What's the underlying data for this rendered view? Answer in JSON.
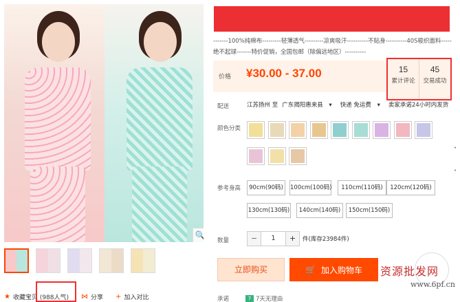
{
  "product": {
    "subtitle": "-------100%纯棉布---------轻薄透气---------凉爽吸汗----------不贴身----------40S梭织面料-----绝不起球-------特价促销，全国包邮（除偏远地区）----------"
  },
  "price": {
    "label": "价格",
    "value": "¥30.00 - 37.00"
  },
  "stats": {
    "reviews": {
      "count": "15",
      "label": "累计评论"
    },
    "sold": {
      "count": "45",
      "label": "交易成功"
    }
  },
  "shipping": {
    "label": "配送",
    "from": "江苏扬州 至",
    "to": "广东揭阳惠来县",
    "to_arrow": "▾",
    "method": "快递 免运费",
    "method_arrow": "▾",
    "promise": "卖家承诺24小时内发货"
  },
  "color": {
    "label": "颜色分类",
    "swatches": [
      {
        "color": "#f1df9a"
      },
      {
        "color": "#e8d9b8"
      },
      {
        "color": "#f3d2a8"
      },
      {
        "color": "#e8c68f"
      },
      {
        "color": "#8fcfcf"
      },
      {
        "color": "#a7ddd4"
      },
      {
        "color": "#d9b4e3"
      },
      {
        "color": "#f2b7c1"
      },
      {
        "color": "#c6c6e8"
      },
      {
        "color": "#e8c4d6"
      },
      {
        "color": "#f3e0a8"
      },
      {
        "color": "#e6c8a6"
      }
    ]
  },
  "size": {
    "label": "参考身高",
    "options": [
      "90cm(90码)",
      "100cm(100码)",
      "110cm(110码)",
      "120cm(120码)",
      "130cm(130码)",
      "140cm(140码)",
      "150cm(150码)"
    ]
  },
  "quantity": {
    "label": "数量",
    "minus": "−",
    "value": "1",
    "plus": "+",
    "stock": "件(库存23984件)"
  },
  "actions": {
    "buy_now": "立即购买",
    "add_cart": "加入购物车",
    "cart_icon": "🛒"
  },
  "promise_row": {
    "label": "承诺",
    "badge": "7",
    "text": "7天无理由"
  },
  "bottom": {
    "favorite_icon": "★",
    "favorite": "收藏宝贝 (988人气)",
    "share_icon": "⋈",
    "share": "分享",
    "compare_icon": "+",
    "compare": "加入对比"
  },
  "zoom_icon": "🔍",
  "side_markers": [
    "◂",
    "◂"
  ],
  "watermark": {
    "text": "资源批发网",
    "url": "www.6pf.cn"
  },
  "colors": {
    "accent": "#ff4400",
    "red_box": "#ec2f32",
    "price_bg": "#fff2e8"
  }
}
